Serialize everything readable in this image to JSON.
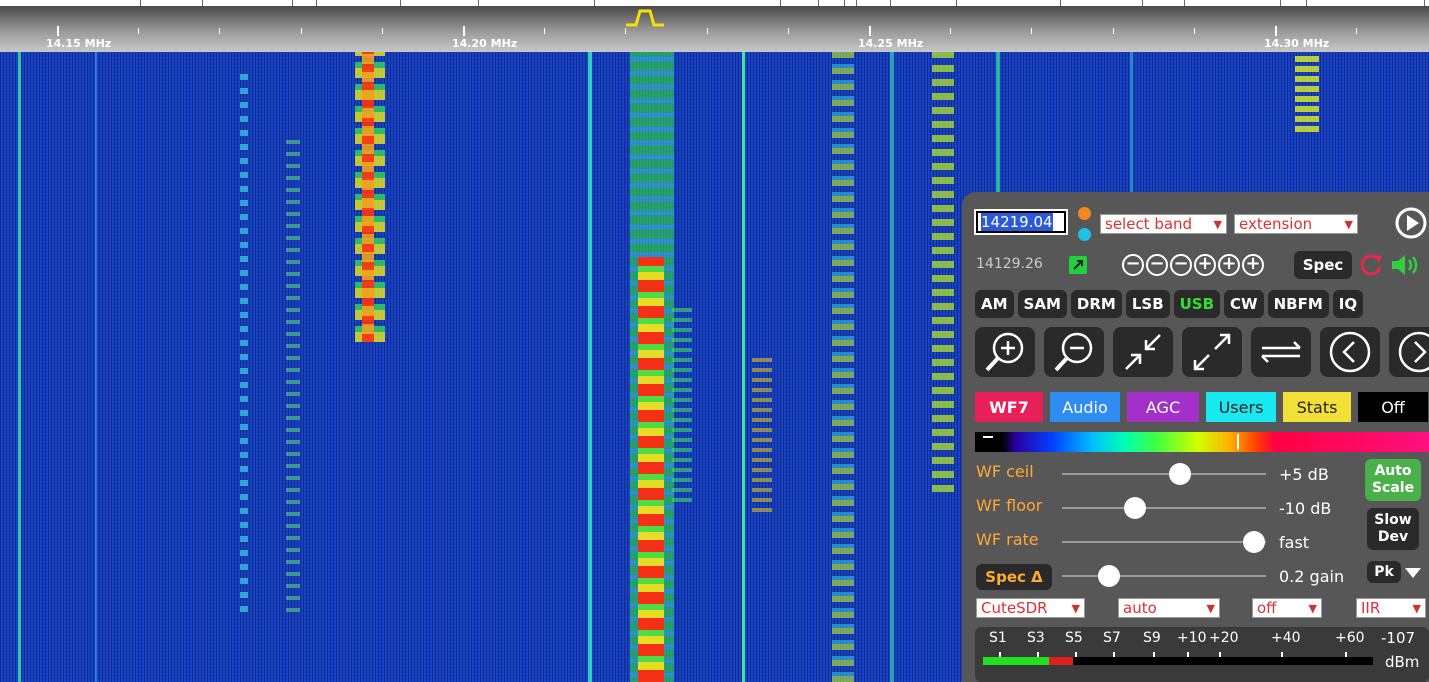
{
  "scale": {
    "labels": [
      "14.15 MHz",
      "14.20 MHz",
      "14.25 MHz",
      "14.30 MHz"
    ]
  },
  "tuning": {
    "frequency": "14219.04",
    "band_select": "select band",
    "extension_select": "extension",
    "last_freq": "14129.26"
  },
  "zoom": {
    "spec_label": "Spec"
  },
  "modes": [
    "AM",
    "SAM",
    "DRM",
    "LSB",
    "USB",
    "CW",
    "NBFM",
    "IQ"
  ],
  "active_mode": "USB",
  "tabs": [
    {
      "label": "WF7",
      "bg": "#e8205a",
      "fg": "#ffffff"
    },
    {
      "label": "Audio",
      "bg": "#2f8cf0",
      "fg": "#ffffff"
    },
    {
      "label": "AGC",
      "bg": "#a330c8",
      "fg": "#ffffff"
    },
    {
      "label": "Users",
      "bg": "#18e8f0",
      "fg": "#222222"
    },
    {
      "label": "Stats",
      "bg": "#f0e038",
      "fg": "#222222"
    },
    {
      "label": "Off",
      "bg": "#000000",
      "fg": "#ffffff"
    }
  ],
  "sliders": {
    "wf_ceil": {
      "label": "WF ceil",
      "value": "+5 dB",
      "level": 0.58
    },
    "wf_floor": {
      "label": "WF floor",
      "value": "-10 dB",
      "level": 0.36
    },
    "wf_rate": {
      "label": "WF rate",
      "value": "fast",
      "level": 0.94
    },
    "spec_delta": {
      "label": "Spec Δ",
      "value": "0.2 gain",
      "level": 0.23
    }
  },
  "buttons": {
    "auto_scale": [
      "Auto",
      "Scale"
    ],
    "slow_dev": [
      "Slow",
      "Dev"
    ],
    "pk": "Pk"
  },
  "selects": {
    "noise_blanker": "CuteSDR",
    "auto": "auto",
    "off": "off",
    "filter": "IIR"
  },
  "smeter": {
    "labels": [
      "S1",
      "S3",
      "S5",
      "S7",
      "S9",
      "+10",
      "+20",
      "+40",
      "+60"
    ],
    "reading": "-107",
    "unit": "dBm"
  },
  "colors": {
    "accent_orange": "#ffaa33",
    "usb_green": "#30e030",
    "auto_scale_green": "#4ab04a"
  }
}
